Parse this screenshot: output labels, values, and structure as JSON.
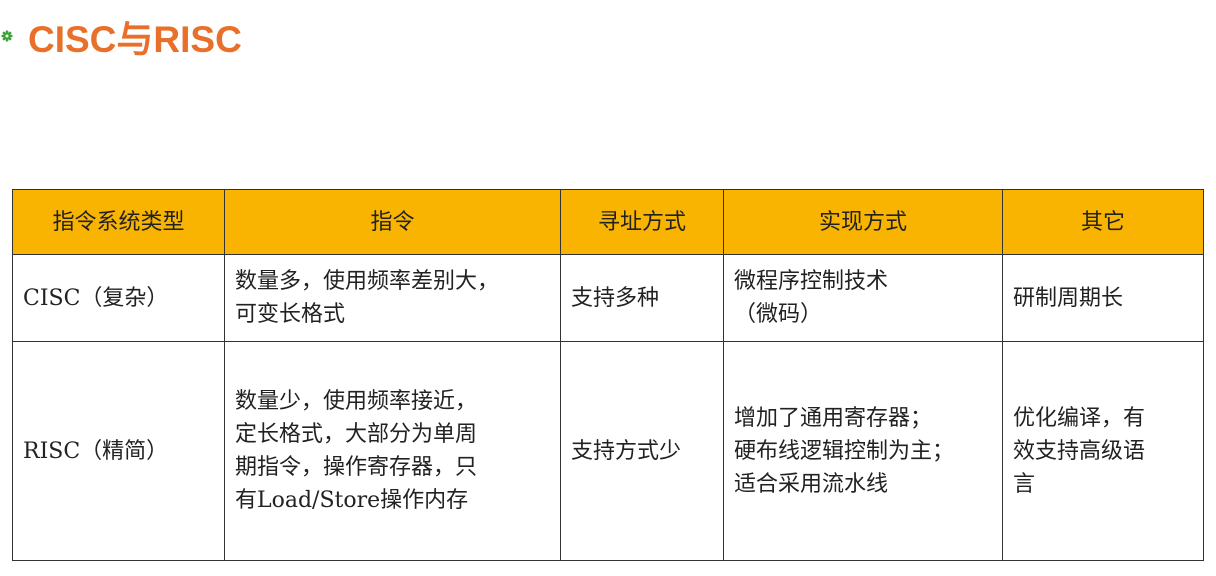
{
  "slide": {
    "title": "CISC与RISC",
    "bullet_icon": "gear-icon",
    "bullet_color": "#3aa335",
    "title_color": "#e8702a"
  },
  "table": {
    "header_bg": "#f8b400",
    "headers": [
      "指令系统类型",
      "指令",
      "寻址方式",
      "实现方式",
      "其它"
    ],
    "rows": [
      {
        "type": "CISC（复杂）",
        "instructions": [
          "数量多，使用频率差别大，",
          "可变长格式"
        ],
        "addressing": "支持多种",
        "implementation": [
          "微程序控制技术",
          "（微码）"
        ],
        "other": [
          "研制周期长"
        ]
      },
      {
        "type": "RISC（精简）",
        "instructions": [
          "数量少，使用频率接近，",
          "定长格式，大部分为单周",
          "期指令，操作寄存器，只",
          "有Load/Store操作内存"
        ],
        "addressing": "支持方式少",
        "implementation": [
          "增加了通用寄存器；",
          "硬布线逻辑控制为主；",
          "适合采用流水线"
        ],
        "other": [
          "优化编译，有",
          "效支持高级语",
          "言"
        ]
      }
    ]
  }
}
